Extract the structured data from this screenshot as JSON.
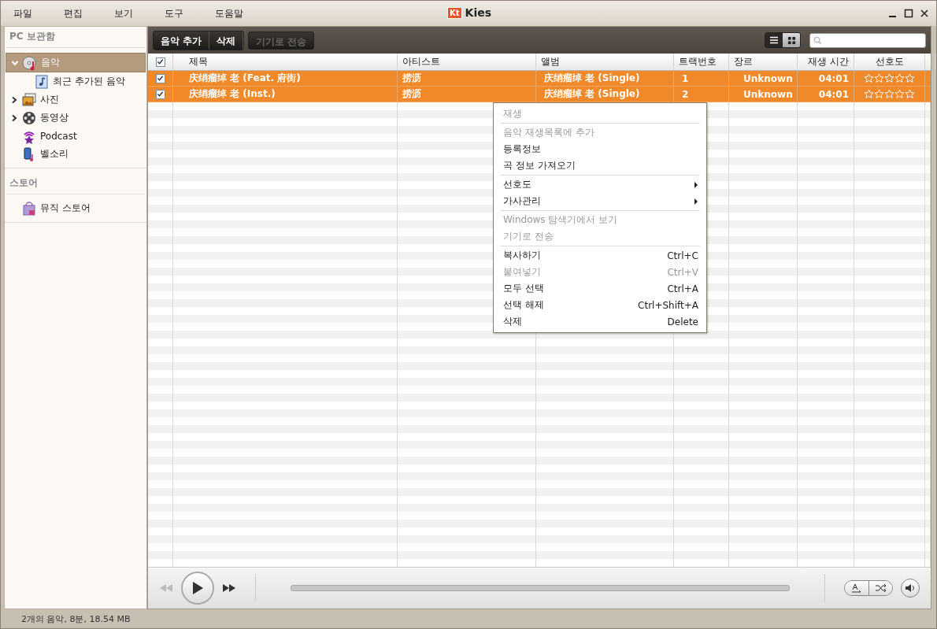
{
  "menubar": [
    "파일",
    "편집",
    "보기",
    "도구",
    "도움말"
  ],
  "window": {
    "title": "Kies",
    "logo": "Kt"
  },
  "sidebar": {
    "sections": [
      {
        "title": "PC 보관함",
        "items": [
          {
            "label": "음악",
            "kind": "music",
            "expanded": true,
            "selected": true,
            "children": [
              {
                "label": "최근 추가된 음악",
                "kind": "note",
                "selected": false
              }
            ]
          },
          {
            "label": "사진",
            "kind": "photo",
            "expanded": false,
            "selected": false
          },
          {
            "label": "동영상",
            "kind": "film",
            "expanded": false,
            "selected": false
          },
          {
            "label": "Podcast",
            "kind": "podcast",
            "selected": false
          },
          {
            "label": "벨소리",
            "kind": "phone",
            "selected": false
          }
        ]
      },
      {
        "title": "스토어",
        "items": [
          {
            "label": "뮤직 스토어",
            "kind": "store",
            "selected": false
          }
        ]
      }
    ]
  },
  "toolbar": {
    "buttons": [
      {
        "label": "음악 추가",
        "disabled": false
      },
      {
        "label": "삭제",
        "disabled": false
      },
      {
        "label": "기기로 전송",
        "disabled": true
      }
    ],
    "view_modes": [
      {
        "kind": "list",
        "selected": true
      },
      {
        "kind": "grid",
        "selected": false
      }
    ]
  },
  "table": {
    "all_checked": true,
    "columns": [
      "제목",
      "아티스트",
      "앨범",
      "트랙번호",
      "장르",
      "재생 시간",
      "선호도"
    ],
    "rows": [
      {
        "checked": true,
        "selected": true,
        "title": "庆绡瘤绰 老 (Feat. 府街)",
        "artist": "捞沥",
        "album": "庆绡瘤绰 老 (Single)",
        "track": "1",
        "genre": "Unknown",
        "duration": "04:01",
        "stars": 0
      },
      {
        "checked": true,
        "selected": true,
        "title": "庆绡瘤绰 老 (Inst.)",
        "artist": "捞沥",
        "album": "庆绡瘤绰 老 (Single)",
        "track": "2",
        "genre": "Unknown",
        "duration": "04:01",
        "stars": 0
      }
    ]
  },
  "context_menu": {
    "groups": [
      [
        {
          "label": "재생",
          "disabled": true
        }
      ],
      [
        {
          "label": "음악 재생목록에 추가",
          "disabled": true
        },
        {
          "label": "등록정보",
          "disabled": false
        },
        {
          "label": "곡 정보 가져오기",
          "disabled": false
        }
      ],
      [
        {
          "label": "선호도",
          "disabled": false,
          "submenu": true
        },
        {
          "label": "가사관리",
          "disabled": false,
          "submenu": true
        }
      ],
      [
        {
          "label": "Windows 탐색기에서 보기",
          "disabled": true
        },
        {
          "label": "기기로 전송",
          "disabled": true
        }
      ],
      [
        {
          "label": "복사하기",
          "shortcut": "Ctrl+C",
          "disabled": false
        },
        {
          "label": "붙여넣기",
          "shortcut": "Ctrl+V",
          "disabled": true
        },
        {
          "label": "모두 선택",
          "shortcut": "Ctrl+A",
          "disabled": false
        },
        {
          "label": "선택 해제",
          "shortcut": "Ctrl+Shift+A",
          "disabled": false
        },
        {
          "label": "삭제",
          "shortcut": "Delete",
          "disabled": false
        }
      ]
    ]
  },
  "player": {
    "progress": {
      "level": 0
    }
  },
  "status_bar": "2개의 음악, 8분, 18.54 MB"
}
